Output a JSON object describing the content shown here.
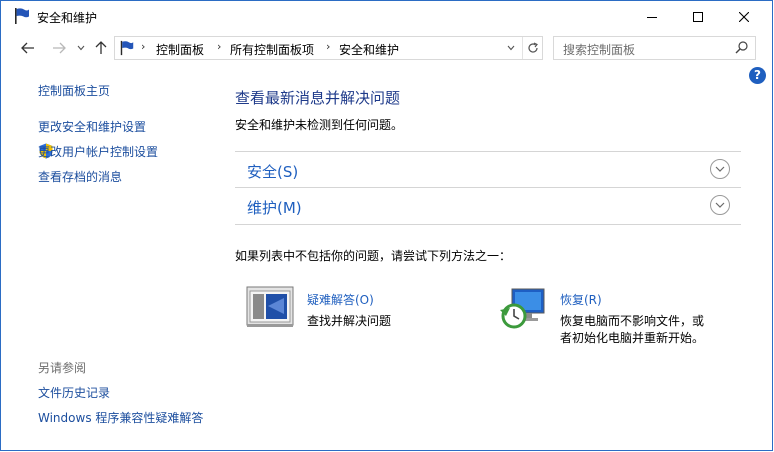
{
  "window": {
    "title": "安全和维护"
  },
  "nav": {
    "breadcrumbs": [
      "控制面板",
      "所有控制面板项",
      "安全和维护"
    ],
    "search_placeholder": "搜索控制面板"
  },
  "sidebar": {
    "home": "控制面板主页",
    "links": [
      "更改安全和维护设置",
      "更改用户帐户控制设置",
      "查看存档的消息"
    ],
    "see_also_heading": "另请参阅",
    "see_also": [
      "文件历史记录",
      "Windows 程序兼容性疑难解答"
    ]
  },
  "main": {
    "title": "查看最新消息并解决问题",
    "subtitle": "安全和维护未检测到任何问题。",
    "sections": [
      {
        "label": "安全(S)"
      },
      {
        "label": "维护(M)"
      }
    ],
    "hint": "如果列表中不包括你的问题，请尝试下列方法之一：",
    "tools": [
      {
        "title": "疑难解答(O)",
        "desc": "查找并解决问题"
      },
      {
        "title": "恢复(R)",
        "desc": "恢复电脑而不影响文件，或者初始化电脑并重新开始。"
      }
    ]
  },
  "colors": {
    "link": "#1c4e9e",
    "heading": "#1e3a8a",
    "section": "#1f5fbf",
    "border": "#d5d5d5"
  }
}
